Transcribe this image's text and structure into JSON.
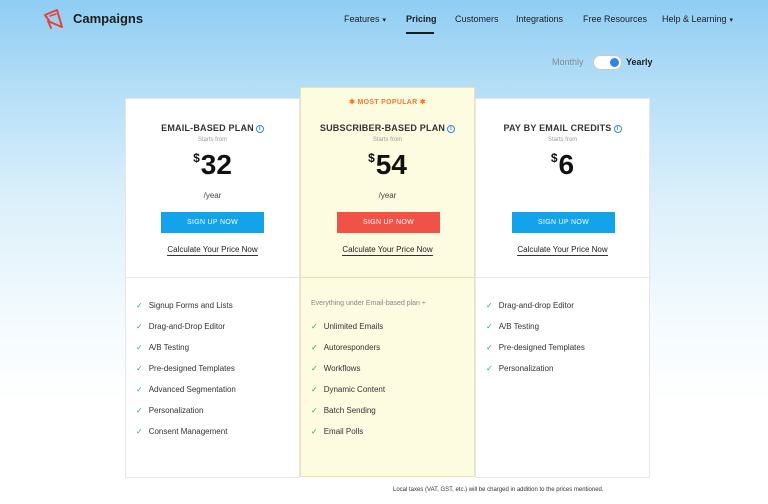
{
  "nav": {
    "brand": "Campaigns",
    "items": [
      {
        "label": "Features",
        "caret": "▾"
      },
      {
        "label": "Pricing"
      },
      {
        "label": "Customers"
      },
      {
        "label": "Integrations"
      },
      {
        "label": "Free Resources"
      },
      {
        "label": "Help & Learning",
        "caret": "▾"
      }
    ],
    "active": "Pricing",
    "logo_color": "#e8403a"
  },
  "billing_toggle": {
    "monthly": "Monthly",
    "yearly": "Yearly",
    "selected": "Yearly"
  },
  "plans": [
    {
      "title": "EMAIL-BASED PLAN",
      "starts": "Starts from",
      "currency": "$",
      "price": "32",
      "period": "/year",
      "cta": "SIGN UP NOW",
      "calc": "Calculate Your Price Now",
      "features": [
        "Signup Forms and Lists",
        "Drag-and-Drop Editor",
        "A/B Testing",
        "Pre-designed Templates",
        "Advanced Segmentation",
        "Personalization",
        "Consent Management"
      ]
    },
    {
      "badge": "✱ MOST POPULAR ✱",
      "title": "SUBSCRIBER-BASED PLAN",
      "starts": "Starts from",
      "currency": "$",
      "price": "54",
      "period": "/year",
      "cta": "SIGN UP NOW",
      "calc": "Calculate Your Price Now",
      "intro": "Everything under Email-based plan +",
      "features": [
        "Unlimited Emails",
        "Autoresponders",
        "Workflows",
        "Dynamic Content",
        "Batch Sending",
        "Email Polls"
      ]
    },
    {
      "title": "PAY BY EMAIL CREDITS",
      "starts": "Starts from",
      "currency": "$",
      "price": "6",
      "cta": "SIGN UP NOW",
      "calc": "Calculate Your Price Now",
      "features": [
        "Drag-and-drop Editor",
        "A/B Testing",
        "Pre-designed Templates",
        "Personalization"
      ]
    }
  ],
  "footnote": "Local taxes (VAT, GST, etc.) will be charged in addition to the prices mentioned.",
  "colors": {
    "accent_blue": "#12a3ea",
    "cta_red": "#f05346",
    "popular_orange": "#f07a2a",
    "check_green": "#24a96b"
  }
}
